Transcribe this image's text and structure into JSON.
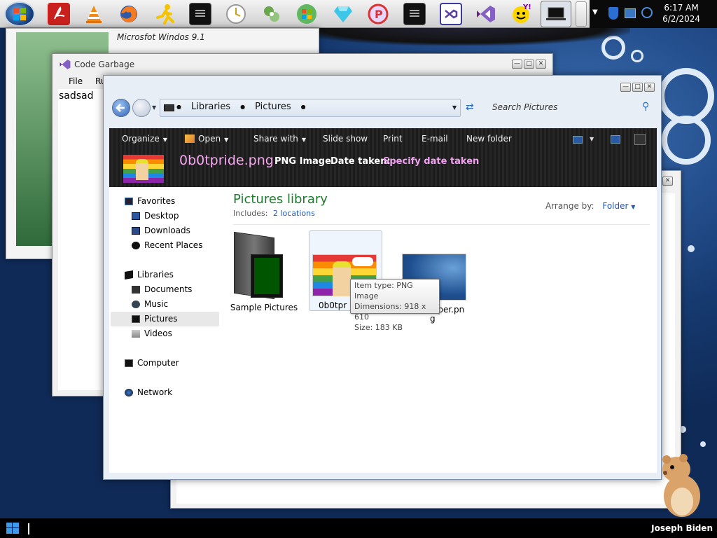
{
  "taskbar": {
    "icons": [
      "start-orb-icon",
      "acrobat-icon",
      "vlc-icon",
      "firefox-icon",
      "aim-icon",
      "console-icon",
      "clock-icon",
      "sysmon-icon",
      "windows-logo-icon",
      "gem-icon",
      "pixel-icon",
      "console-icon",
      "visual-studio-icon",
      "visual-studio-icon",
      "yahoo-icon",
      "laptop-icon"
    ],
    "clock_time": "6:17 AM",
    "clock_date": "6/2/2024"
  },
  "bg_window": {
    "title": "Microsfot Windos 9.1"
  },
  "code_window": {
    "title": "Code Garbage",
    "menu": [
      "File",
      "Ru"
    ],
    "body_text": "sadsad"
  },
  "explorer": {
    "breadcrumb": [
      "Libraries",
      "Pictures"
    ],
    "search_placeholder": "Search Pictures",
    "commands": [
      "Organize",
      "Open",
      "Share with",
      "Slide show",
      "Print",
      "E-mail",
      "New folder"
    ],
    "file_name": "0b0tpride.png",
    "file_type": "PNG Image",
    "date_label": "Date taken:",
    "date_value": "Specify date taken",
    "library_title": "Pictures library",
    "includes_label": "Includes:",
    "includes_link": "2 locations",
    "arrange_label": "Arrange by:",
    "arrange_value": "Folder",
    "nav": {
      "favorites": "Favorites",
      "desktop": "Desktop",
      "downloads": "Downloads",
      "recent": "Recent Places",
      "libraries": "Libraries",
      "documents": "Documents",
      "music": "Music",
      "pictures": "Pictures",
      "videos": "Videos",
      "computer": "Computer",
      "network": "Network"
    },
    "items": [
      {
        "label": "Sample Pictures"
      },
      {
        "label": "0b0tpr"
      },
      {
        "label": "aper.pn",
        "label2": "g"
      }
    ],
    "tooltip": {
      "type": "Item type: PNG Image",
      "dims": "Dimensions: 918 x 610",
      "size": "Size: 183 KB"
    }
  },
  "bottom": {
    "user": "Joseph Biden"
  },
  "colors": {
    "accent_green": "#1e7b2e",
    "link_blue": "#2156b8",
    "pink": "#f0a0f0"
  }
}
